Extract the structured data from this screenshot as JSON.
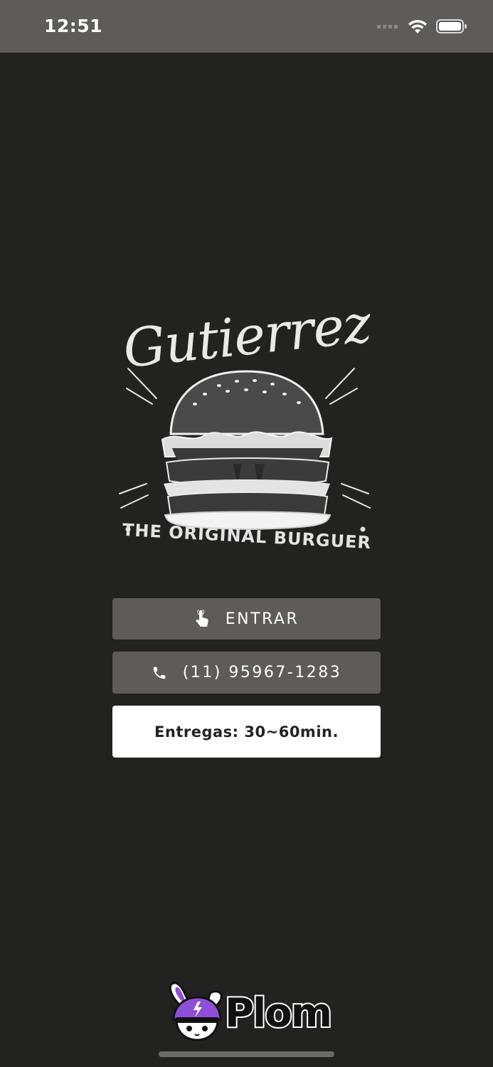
{
  "status_bar": {
    "time": "12:51",
    "icons": [
      "signal-icon",
      "wifi-icon",
      "battery-icon"
    ]
  },
  "logo": {
    "brand": "Gutierrez",
    "tagline": "THE ORIGINAL BURGUER",
    "image": "burger-illustration"
  },
  "buttons": {
    "enter": {
      "label": "ENTRAR",
      "icon": "tap-hand-icon"
    },
    "phone": {
      "label": "(11) 95967-1283",
      "icon": "phone-icon"
    },
    "delivery": {
      "label": "Entregas: 30~60min."
    }
  },
  "footer": {
    "brand": "Plom",
    "mascot": "bunny-helmet-logo"
  },
  "colors": {
    "background": "#222321",
    "status_bar": "#5f5b5b",
    "button_dark": "#5f5b5b",
    "button_light": "#ffffff",
    "accent_purple": "#8e4fd8"
  }
}
